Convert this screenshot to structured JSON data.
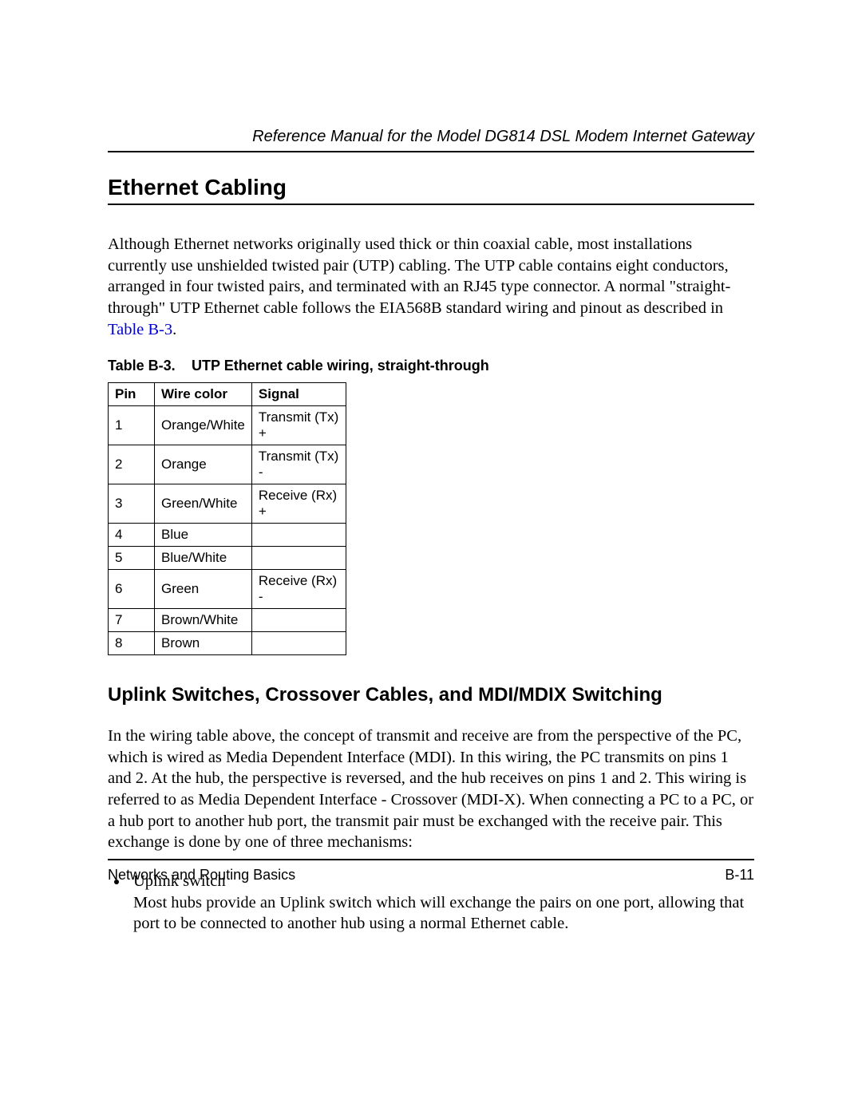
{
  "header": {
    "title": "Reference Manual for the Model DG814 DSL Modem Internet Gateway"
  },
  "section": {
    "heading": "Ethernet Cabling",
    "intro_before_link": "Although Ethernet networks originally used thick or thin coaxial cable, most installations currently use unshielded twisted pair (UTP) cabling. The UTP cable contains eight conductors, arranged in four twisted pairs, and terminated with an RJ45 type connector. A normal \"straight-through\" UTP Ethernet cable follows the EIA568B standard wiring and pinout as described in ",
    "intro_link": "Table B-3",
    "intro_after_link": "."
  },
  "chart_data": {
    "type": "table",
    "caption_label": "Table B-3.",
    "caption_title": "UTP Ethernet cable wiring, straight-through",
    "columns": [
      "Pin",
      "Wire color",
      "Signal"
    ],
    "rows": [
      {
        "pin": "1",
        "color": "Orange/White",
        "signal": "Transmit (Tx) +"
      },
      {
        "pin": "2",
        "color": "Orange",
        "signal": "Transmit (Tx) -"
      },
      {
        "pin": "3",
        "color": "Green/White",
        "signal": "Receive (Rx) +"
      },
      {
        "pin": "4",
        "color": "Blue",
        "signal": ""
      },
      {
        "pin": "5",
        "color": "Blue/White",
        "signal": ""
      },
      {
        "pin": "6",
        "color": "Green",
        "signal": "Receive (Rx) -"
      },
      {
        "pin": "7",
        "color": "Brown/White",
        "signal": ""
      },
      {
        "pin": "8",
        "color": "Brown",
        "signal": ""
      }
    ]
  },
  "subsection": {
    "heading": "Uplink Switches, Crossover Cables, and MDI/MDIX Switching",
    "paragraph": "In the wiring table above, the concept of transmit and receive are from the perspective of the PC, which is wired as Media Dependent Interface (MDI). In this wiring, the PC transmits on pins 1 and 2. At the hub, the perspective is reversed, and the hub receives on pins 1 and 2. This wiring is referred to as Media Dependent Interface - Crossover (MDI-X). When connecting a PC to a PC, or a hub port to another hub port, the transmit pair must be exchanged with the receive pair. This exchange is done by one of three mechanisms:",
    "bullets": [
      {
        "title": "Uplink switch",
        "body": "Most hubs provide an Uplink switch which will exchange the pairs on one port, allowing that port to be connected to another hub using a normal Ethernet cable."
      }
    ]
  },
  "footer": {
    "left": "Networks and Routing Basics",
    "right": "B-11"
  }
}
